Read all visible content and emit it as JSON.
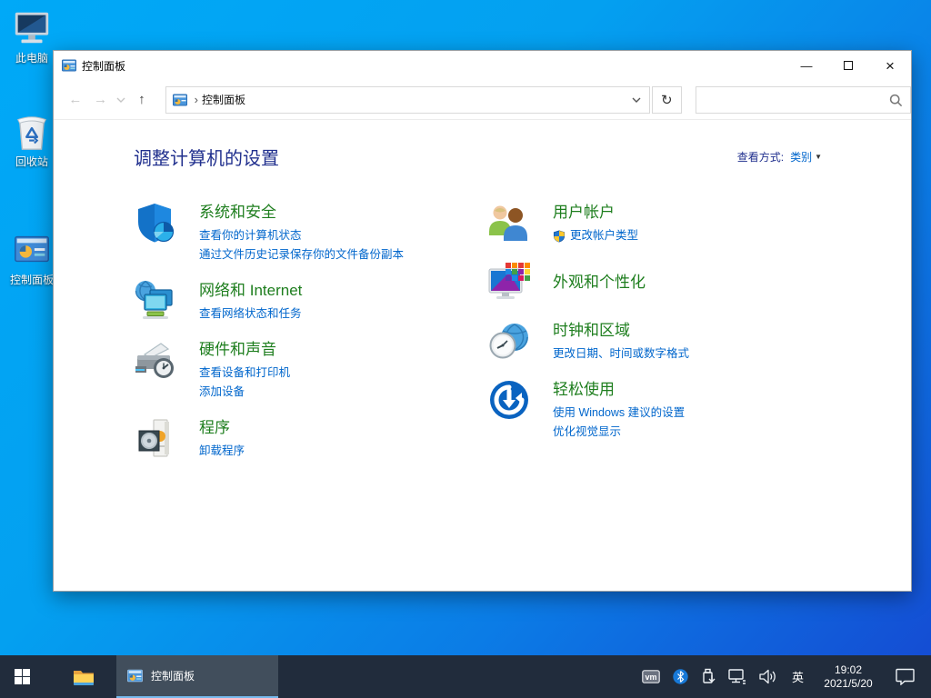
{
  "desktop": {
    "icons": [
      {
        "label": "此电脑"
      },
      {
        "label": "回收站"
      },
      {
        "label": "控制面板"
      }
    ]
  },
  "window": {
    "title": "控制面板",
    "nav": {
      "breadcrumb_root": "控制面板",
      "breadcrumb_sep": "›"
    },
    "header": "调整计算机的设置",
    "view_by": {
      "label": "查看方式:",
      "value": "类别",
      "caret": "▼"
    },
    "categories_left": [
      {
        "title": "系统和安全",
        "links": [
          "查看你的计算机状态",
          "通过文件历史记录保存你的文件备份副本"
        ]
      },
      {
        "title": "网络和 Internet",
        "links": [
          "查看网络状态和任务"
        ]
      },
      {
        "title": "硬件和声音",
        "links": [
          "查看设备和打印机",
          "添加设备"
        ]
      },
      {
        "title": "程序",
        "links": [
          "卸载程序"
        ]
      }
    ],
    "categories_right": [
      {
        "title": "用户帐户",
        "links": [
          "更改帐户类型"
        ]
      },
      {
        "title": "外观和个性化",
        "links": []
      },
      {
        "title": "时钟和区域",
        "links": [
          "更改日期、时间或数字格式"
        ]
      },
      {
        "title": "轻松使用",
        "links": [
          "使用 Windows 建议的设置",
          "优化视觉显示"
        ]
      }
    ]
  },
  "taskbar": {
    "task_label": "控制面板",
    "tray": {
      "ime": "英",
      "time": "19:02",
      "date": "2021/5/20"
    }
  },
  "colors": {
    "category_green": "#1e7e1e",
    "link_blue": "#0066cc",
    "header_navy": "#21308e",
    "taskbar_bg": "#212c3c",
    "task_underline": "#76b9ed"
  }
}
